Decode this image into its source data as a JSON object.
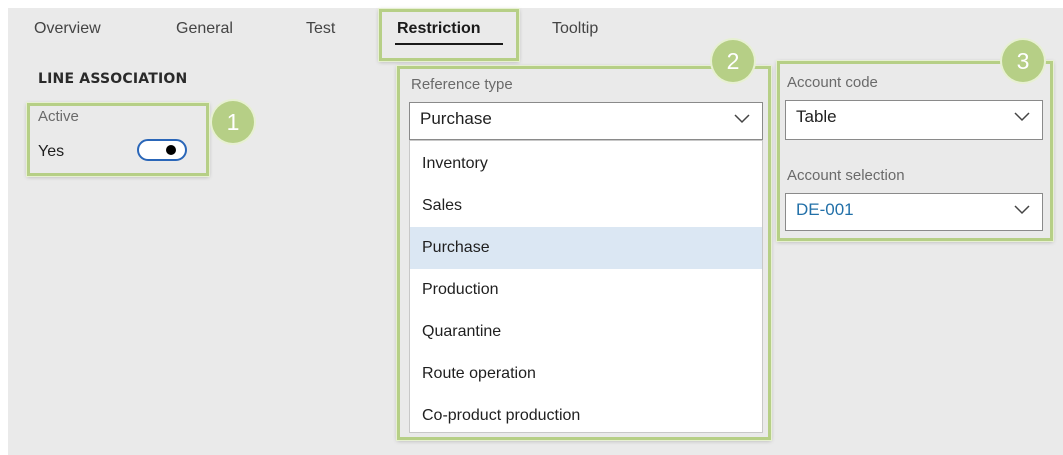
{
  "tabs": [
    {
      "label": "Overview",
      "active": false
    },
    {
      "label": "General",
      "active": false
    },
    {
      "label": "Test",
      "active": false
    },
    {
      "label": "Restriction",
      "active": true
    },
    {
      "label": "Tooltip",
      "active": false
    }
  ],
  "line_association": {
    "section_title": "LINE ASSOCIATION",
    "active_label": "Active",
    "active_value": "Yes",
    "toggle_on": true
  },
  "reference_type": {
    "label": "Reference type",
    "selected": "Purchase",
    "options": [
      "Inventory",
      "Sales",
      "Purchase",
      "Production",
      "Quarantine",
      "Route operation",
      "Co-product production"
    ]
  },
  "account": {
    "code_label": "Account code",
    "code_value": "Table",
    "selection_label": "Account selection",
    "selection_value": "DE-001"
  },
  "callouts": [
    "1",
    "2",
    "3"
  ],
  "colors": {
    "highlight": "#b6cf86",
    "accent": "#2270a8",
    "toggle_border": "#2a66b8",
    "selected_row": "#dbe7f3"
  }
}
